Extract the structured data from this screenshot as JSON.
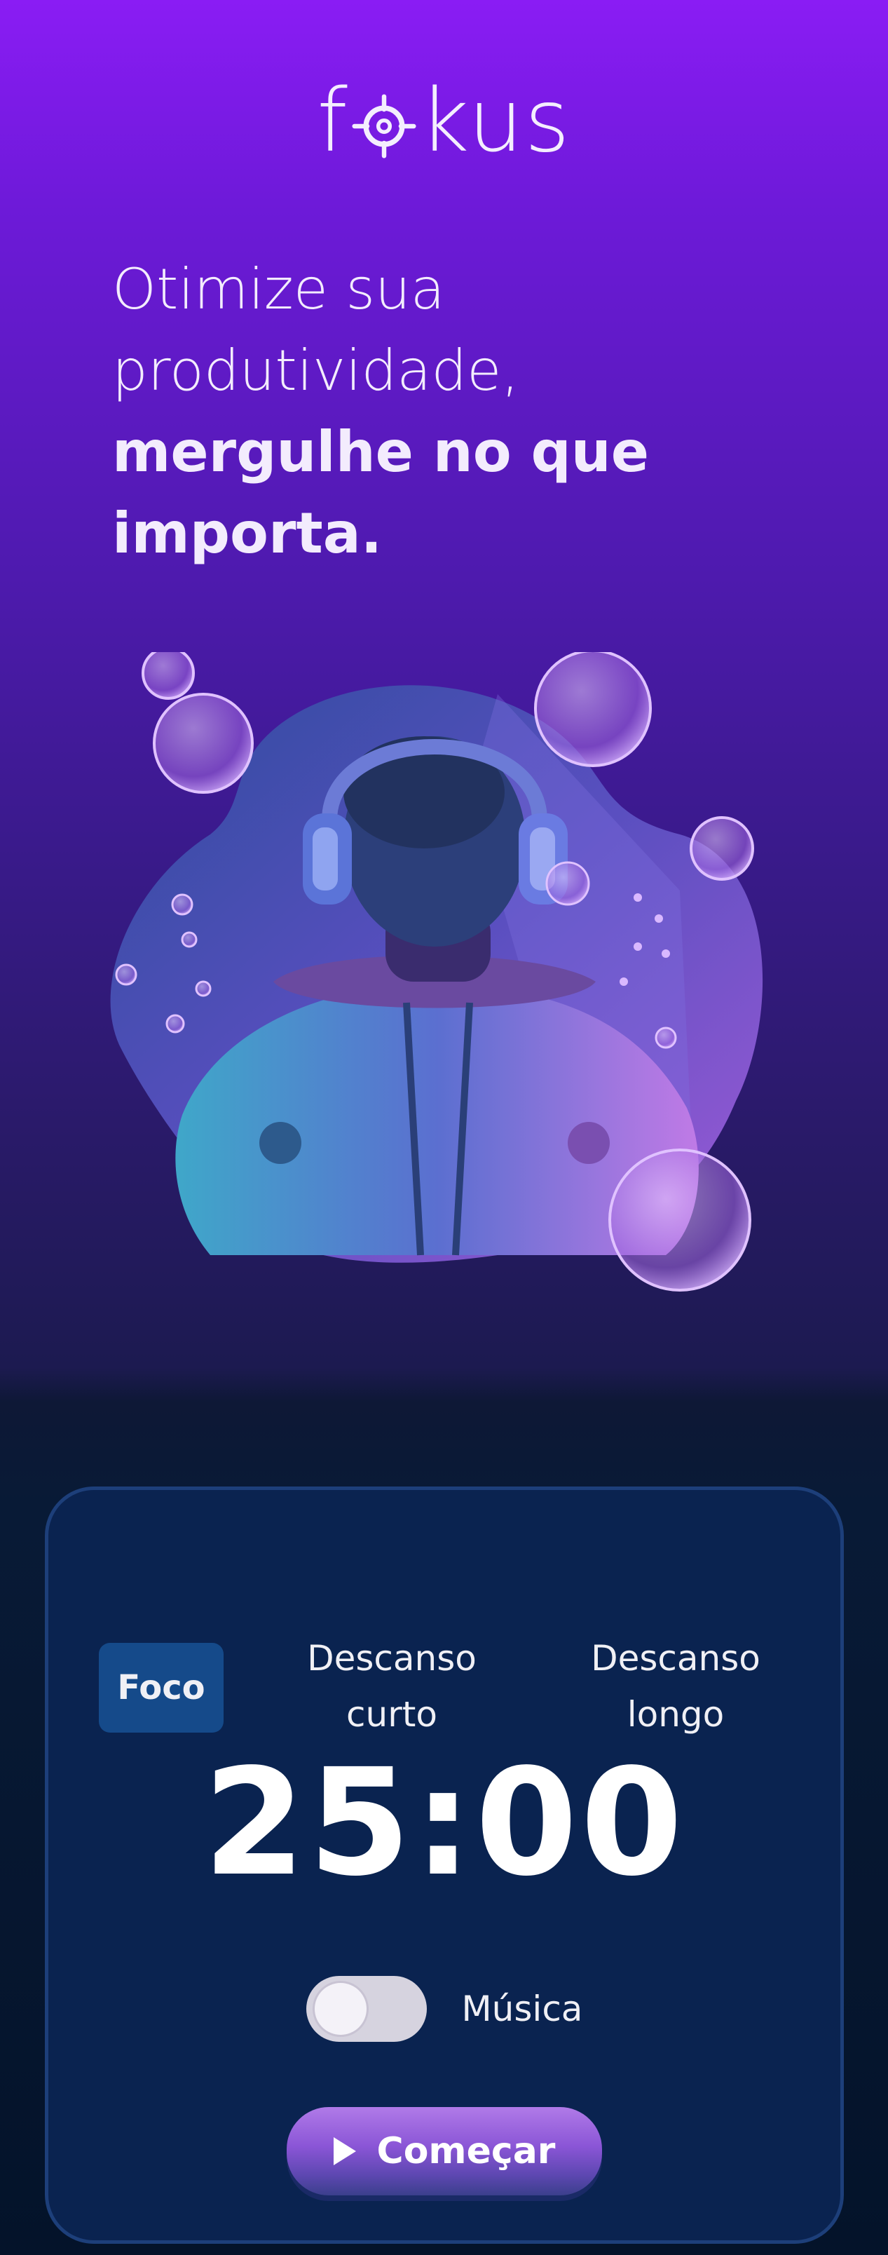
{
  "header": {
    "logo_left": "f",
    "logo_right": "kus"
  },
  "headline": {
    "line1": "Otimize sua",
    "line2": "produtividade,",
    "line3": "mergulhe no que",
    "line4": "importa."
  },
  "hero": {
    "icon": "astronaut-headphones-illustration"
  },
  "timer_card": {
    "tabs": [
      {
        "line1": "Foco",
        "line2": ""
      },
      {
        "line1": "Descanso",
        "line2": "curto"
      },
      {
        "line1": "Descanso",
        "line2": "longo"
      }
    ],
    "active_tab": "Foco",
    "time": "25:00",
    "music_label": "Música",
    "music_enabled": false,
    "start_label": "Começar"
  },
  "colors": {
    "accent_purple": "#8a1cf4",
    "card_background": "#0a2350",
    "active_tab": "#154a8a"
  }
}
